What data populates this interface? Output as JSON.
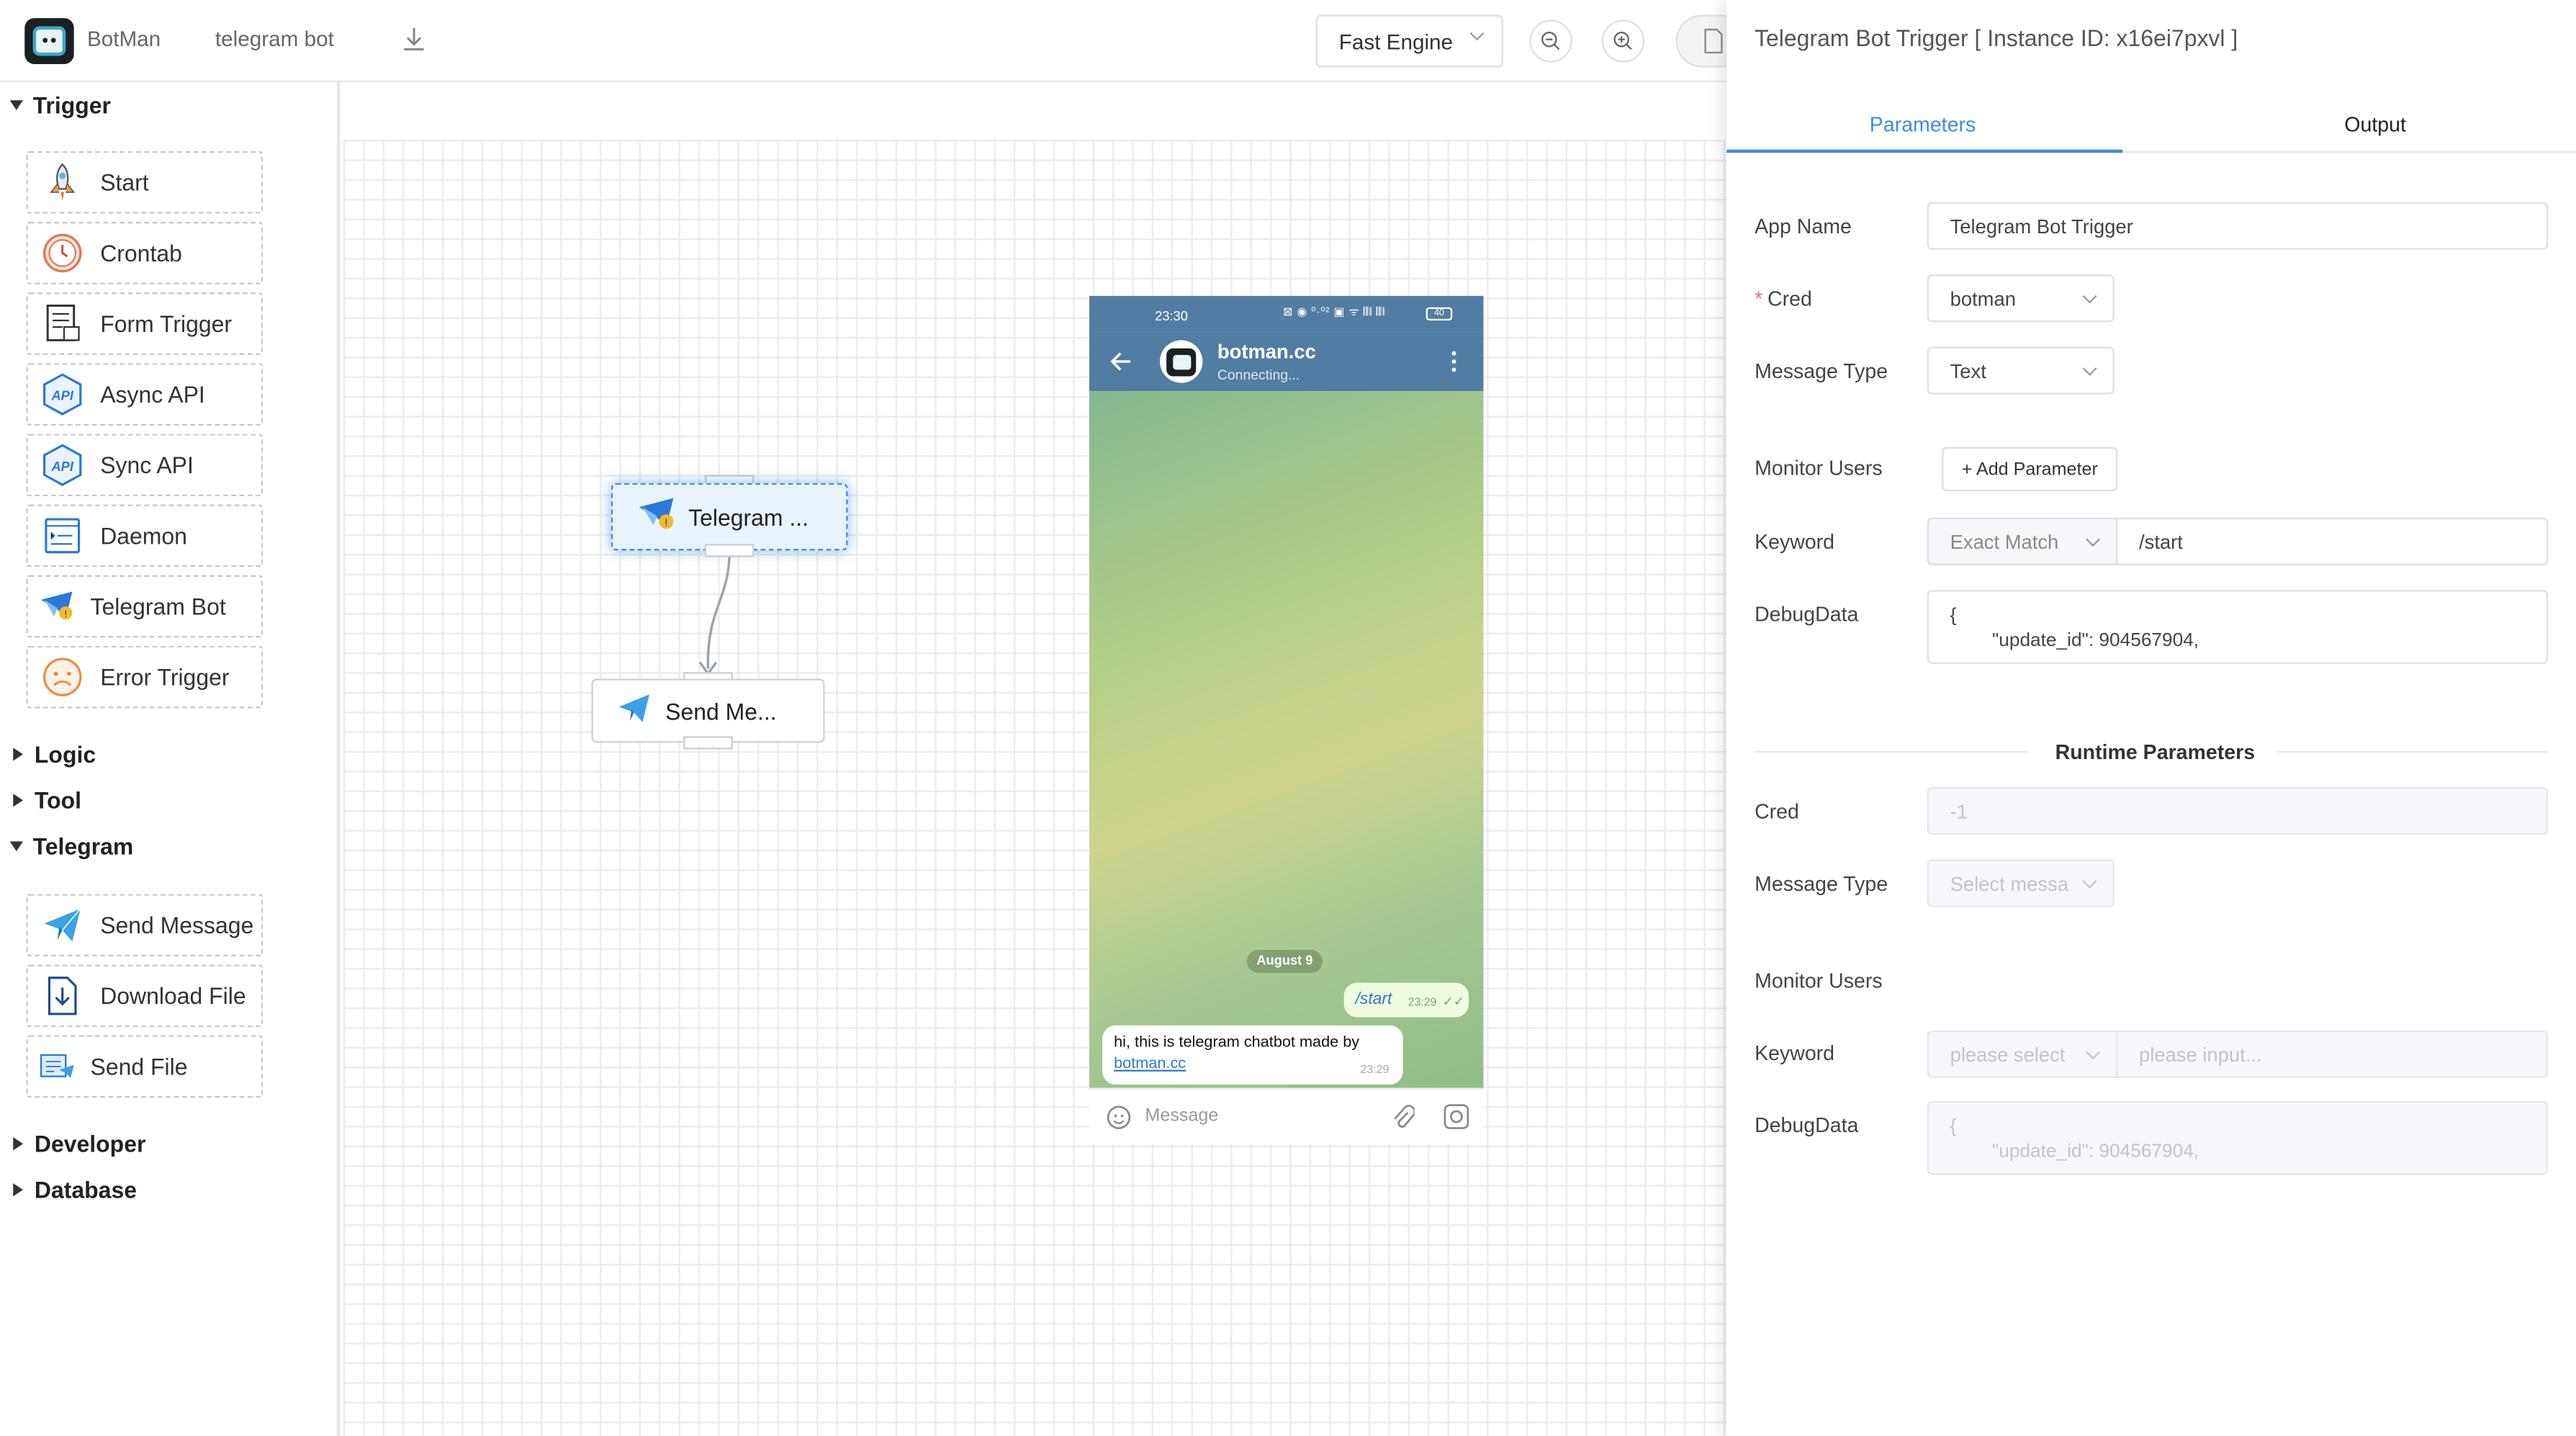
{
  "topbar": {
    "app_name": "BotMan",
    "project_name": "telegram bot",
    "engine_select": "Fast Engine"
  },
  "sidebar": {
    "categories": [
      {
        "label": "Trigger",
        "expanded": true
      },
      {
        "label": "Logic",
        "expanded": false
      },
      {
        "label": "Tool",
        "expanded": false
      },
      {
        "label": "Telegram",
        "expanded": true
      },
      {
        "label": "Developer",
        "expanded": false
      },
      {
        "label": "Database",
        "expanded": false
      }
    ],
    "trigger_items": [
      {
        "label": "Start",
        "icon": "rocket-icon"
      },
      {
        "label": "Crontab",
        "icon": "clock-icon"
      },
      {
        "label": "Form Trigger",
        "icon": "form-icon"
      },
      {
        "label": "Async API",
        "icon": "api-icon"
      },
      {
        "label": "Sync API",
        "icon": "api-icon"
      },
      {
        "label": "Daemon",
        "icon": "daemon-icon"
      },
      {
        "label": "Telegram Bot",
        "icon": "telegram-bot-icon"
      },
      {
        "label": "Error Trigger",
        "icon": "sad-face-icon"
      }
    ],
    "telegram_items": [
      {
        "label": "Send Message",
        "icon": "paper-plane-icon"
      },
      {
        "label": "Download File",
        "icon": "download-file-icon"
      },
      {
        "label": "Send File",
        "icon": "send-file-icon"
      }
    ]
  },
  "canvas": {
    "nodes": [
      {
        "label": "Telegram ...",
        "icon": "telegram-bot-icon",
        "selected": true
      },
      {
        "label": "Send Me...",
        "icon": "paper-plane-icon",
        "selected": false
      }
    ]
  },
  "phone": {
    "status_time": "23:30",
    "status_icons": "⊠ ◉ ⁰·⁰² ▣ ᯤ 𝄃𝄃l 𝄃𝄃l",
    "battery": "40",
    "chat_name": "botman.cc",
    "chat_status": "Connecting...",
    "date_chip": "August 9",
    "outgoing": {
      "text": "/start",
      "time": "23:29"
    },
    "incoming": {
      "text": "hi, this is telegram chatbot made by",
      "link": "botman.cc",
      "time": "23:29"
    },
    "input_placeholder": "Message"
  },
  "panel": {
    "title": "Telegram Bot Trigger [ Instance ID: x16ei7pxvl ]",
    "tabs": [
      {
        "label": "Parameters",
        "active": true
      },
      {
        "label": "Output",
        "active": false
      }
    ],
    "fields": {
      "app_name_label": "App Name",
      "app_name_value": "Telegram Bot Trigger",
      "cred_label": "Cred",
      "cred_value": "botman",
      "message_type_label": "Message Type",
      "message_type_value": "Text",
      "monitor_users_label": "Monitor Users",
      "add_param_label": "+ Add Parameter",
      "keyword_label": "Keyword",
      "keyword_match": "Exact Match",
      "keyword_value": "/start",
      "debug_label": "DebugData",
      "debug_value": "{\n        \"update_id\": 904567904,"
    },
    "runtime": {
      "heading": "Runtime Parameters",
      "cred_label": "Cred",
      "cred_value": "-1",
      "message_type_label": "Message Type",
      "message_type_placeholder": "Select messa",
      "monitor_users_label": "Monitor Users",
      "keyword_label": "Keyword",
      "keyword_select_placeholder": "please select",
      "keyword_input_placeholder": "please input...",
      "debug_label": "DebugData",
      "debug_value": "{\n        \"update_id\": 904567904,"
    }
  },
  "colors": {
    "accent": "#3b8de0",
    "telegram_header": "#527da3",
    "required": "#f56c6c"
  }
}
